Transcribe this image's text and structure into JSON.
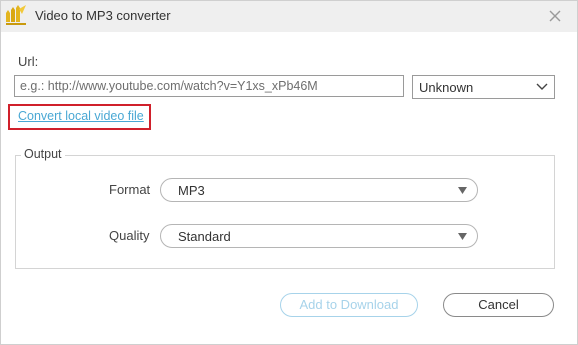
{
  "window": {
    "title": "Video to MP3 converter",
    "app_icon": "app-logo-icon",
    "close_icon": "close-icon"
  },
  "url_section": {
    "label": "Url:",
    "placeholder": "e.g.: http://www.youtube.com/watch?v=Y1xs_xPb46M",
    "value": "",
    "type_select": {
      "value": "Unknown",
      "icon": "chevron-down-icon"
    },
    "local_link": "Convert local video file"
  },
  "output": {
    "legend": "Output",
    "format": {
      "label": "Format",
      "value": "MP3",
      "icon": "triangle-down-icon"
    },
    "quality": {
      "label": "Quality",
      "value": "Standard",
      "icon": "triangle-down-icon"
    }
  },
  "footer": {
    "add_button": "Add to Download",
    "cancel_button": "Cancel"
  },
  "colors": {
    "titlebar_bg": "#efefef",
    "link": "#4aa8d4",
    "highlight_box": "#d0202b",
    "disabled_button": "#a7d3ea",
    "icon_gold": "#e3b51f"
  }
}
